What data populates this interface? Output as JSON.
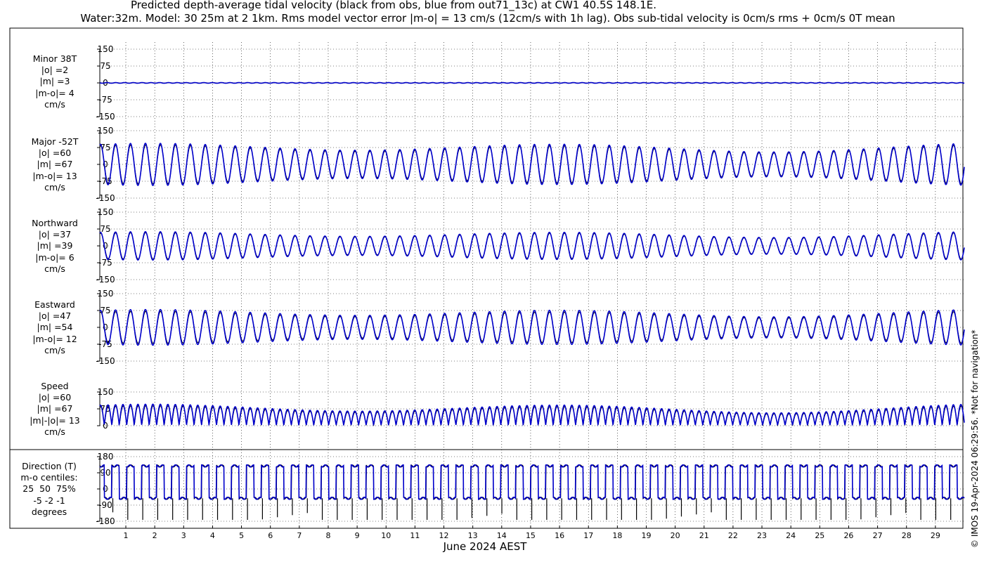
{
  "header": {
    "title_line1": "Predicted depth-average tidal velocity (black from obs, blue from out71_13c) at CW1 40.5S 148.1E.",
    "title_line2": "Water:32m. Model: 30 25m at 2 1km. Rms model vector error |m-o| = 13 cm/s (12cm/s with 1h lag). Obs sub-tidal velocity is 0cm/s rms + 0cm/s 0T mean"
  },
  "side_note": "© IMOS 19-Apr-2024 06:29:56. *Not for navigation*",
  "colors": {
    "obs": "#000000",
    "model": "#0000cc",
    "grid": "#000000"
  },
  "chart_data": [
    {
      "type": "line",
      "name": "minor",
      "label_lines": [
        "Minor 38T",
        "|o| =2",
        "|m| =3",
        "|m-o|= 4",
        "cm/s"
      ],
      "ylim": [
        -150,
        150
      ],
      "yticks": [
        "150",
        "75",
        "0",
        "-75",
        "-150"
      ],
      "amp_obs": 2,
      "amp_model": 3,
      "series": [
        {
          "name": "obs"
        },
        {
          "name": "model"
        }
      ]
    },
    {
      "type": "line",
      "name": "major",
      "label_lines": [
        "Major -52T",
        "|o| =60",
        "|m| =67",
        "|m-o|= 13",
        "cm/s"
      ],
      "ylim": [
        -150,
        150
      ],
      "yticks": [
        "150",
        "75",
        "0",
        "-75",
        "-150"
      ],
      "amp_obs": 85,
      "amp_model": 92,
      "series": [
        {
          "name": "obs"
        },
        {
          "name": "model"
        }
      ]
    },
    {
      "type": "line",
      "name": "northward",
      "label_lines": [
        "Northward",
        "|o| =37",
        "|m| =39",
        "|m-o|= 6",
        "cm/s"
      ],
      "ylim": [
        -150,
        150
      ],
      "yticks": [
        "150",
        "75",
        "0",
        "-75",
        "-150"
      ],
      "amp_obs": 58,
      "amp_model": 62,
      "series": [
        {
          "name": "obs"
        },
        {
          "name": "model"
        }
      ]
    },
    {
      "type": "line",
      "name": "eastward",
      "label_lines": [
        "Eastward",
        "|o| =47",
        "|m| =54",
        "|m-o|= 12",
        "cm/s"
      ],
      "ylim": [
        -150,
        150
      ],
      "yticks": [
        "150",
        "75",
        "0",
        "-75",
        "-150"
      ],
      "amp_obs": 70,
      "amp_model": 78,
      "series": [
        {
          "name": "obs"
        },
        {
          "name": "model"
        }
      ]
    },
    {
      "type": "line",
      "name": "speed",
      "label_lines": [
        "Speed",
        "|o| =60",
        "|m| =67",
        "|m|-|o|= 13",
        "cm/s"
      ],
      "ylim": [
        0,
        150
      ],
      "yticks": [
        "150",
        "75",
        "0"
      ],
      "amp_obs": 85,
      "amp_model": 92,
      "series": [
        {
          "name": "obs"
        },
        {
          "name": "model"
        }
      ]
    },
    {
      "type": "line",
      "name": "direction",
      "label_lines": [
        "Direction (T)",
        "m-o centiles:",
        "25  50  75%",
        "-5 -2 -1",
        "degrees"
      ],
      "ylim": [
        -180,
        180
      ],
      "yticks": [
        "180",
        "90",
        "0",
        "-90",
        "-180"
      ],
      "dir_high": 128,
      "dir_low": -52,
      "series": [
        {
          "name": "obs"
        },
        {
          "name": "model"
        }
      ]
    }
  ],
  "xaxis": {
    "label": "June 2024 AEST",
    "days": [
      "1",
      "2",
      "3",
      "4",
      "5",
      "6",
      "7",
      "8",
      "9",
      "10",
      "11",
      "12",
      "13",
      "14",
      "15",
      "16",
      "17",
      "18",
      "19",
      "20",
      "21",
      "22",
      "23",
      "24",
      "25",
      "26",
      "27",
      "28",
      "29"
    ],
    "range_days": [
      0.1,
      30.0
    ]
  }
}
